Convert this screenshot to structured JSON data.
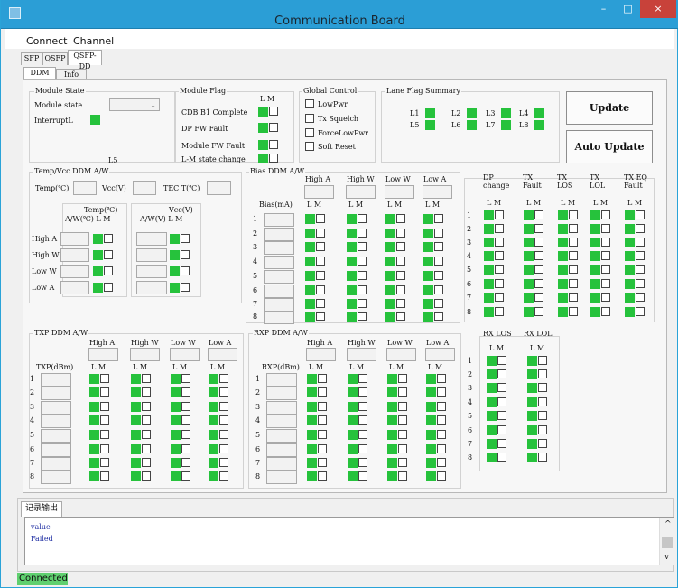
{
  "window": {
    "title": "Communication Board",
    "minimize": "–",
    "maximize": "□",
    "close": "×"
  },
  "menu": [
    "Connect",
    "Channel"
  ],
  "top_tabs": [
    "SFP",
    "QSFP",
    "QSFP-DD"
  ],
  "sub_tabs": [
    "DDM",
    "Info"
  ],
  "module_state": {
    "title": "Module State",
    "state_label": "Module state",
    "interrupt_label": "InterruptL",
    "l5": "L5"
  },
  "module_flag": {
    "title": "Module Flag",
    "lm": "L M",
    "items": [
      "CDB B1 Complete",
      "DP FW Fault",
      "Module FW Fault",
      "L-M state change"
    ]
  },
  "global_control": {
    "title": "Global Control",
    "items": [
      "LowPwr",
      "Tx Squelch",
      "ForceLowPwr",
      "Soft Reset"
    ]
  },
  "lane_flag": {
    "title": "Lane Flag Summary",
    "lanes": [
      "L1",
      "L2",
      "L3",
      "L4",
      "L5",
      "L6",
      "L7",
      "L8"
    ]
  },
  "buttons": {
    "update": "Update",
    "auto_update": "Auto Update"
  },
  "temp_vcc": {
    "title": "Temp/Vcc DDM A/W",
    "temp": "Temp(℃)",
    "vcc": "Vcc(V)",
    "tec": "TEC T(℃)",
    "temp_head": "Temp(℃)",
    "temp_sub": "A/W(℃) L M",
    "vcc_head": "Vcc(V)",
    "vcc_sub": "A/W(V)  L M",
    "rows": [
      "High A",
      "High W",
      "Low W",
      "Low A"
    ]
  },
  "bias": {
    "title": "Bias DDM A/W",
    "col_label": "Bias(mA)",
    "thresholds": [
      "High A",
      "High W",
      "Low W",
      "Low A"
    ]
  },
  "lm": "L M",
  "lane_numbers": [
    "1",
    "2",
    "3",
    "4",
    "5",
    "6",
    "7",
    "8"
  ],
  "dp_flags": {
    "headers": [
      [
        "DP",
        "change"
      ],
      [
        "TX",
        "Fault"
      ],
      [
        "TX",
        "LOS"
      ],
      [
        "TX",
        "LOL"
      ],
      [
        "TX EQ",
        "Fault"
      ]
    ]
  },
  "txp": {
    "title": "TXP DDM A/W",
    "col_label": "TXP(dBm)",
    "thresholds": [
      "High A",
      "High W",
      "Low W",
      "Low A"
    ]
  },
  "rxp": {
    "title": "RXP DDM A/W",
    "col_label": "RXP(dBm)",
    "thresholds": [
      "High A",
      "High W",
      "Low W",
      "Low A"
    ]
  },
  "rx_flags": {
    "headers": [
      "RX LOS",
      "RX LOL"
    ]
  },
  "log": {
    "tab": "记录输出",
    "lines": [
      "value",
      "Failed"
    ]
  },
  "status": "Connected",
  "colors": {
    "flag_on": "#26c23c",
    "title_bar": "#2b9ed6",
    "close_button": "#c8423a",
    "status_bar": "#5fd06f",
    "log_text": "#1f2ea3"
  }
}
